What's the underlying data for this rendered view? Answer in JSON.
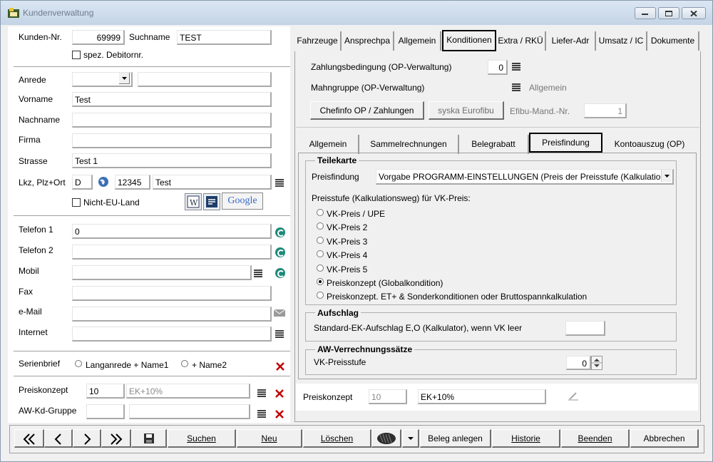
{
  "window": {
    "title": "Kundenverwaltung"
  },
  "left": {
    "kunden_nr_label": "Kunden-Nr.",
    "kunden_nr_value": "69999",
    "suchname_label": "Suchname",
    "suchname_value": "TEST",
    "spez_debitor_label": "spez. Debitornr.",
    "anrede_label": "Anrede",
    "anrede_value": "",
    "anrede_extra_value": "",
    "vorname_label": "Vorname",
    "vorname_value": "Test",
    "nachname_label": "Nachname",
    "nachname_value": "",
    "firma_label": "Firma",
    "firma_value": "",
    "strasse_label": "Strasse",
    "strasse_value": "Test 1",
    "lkz_label": "Lkz, Plz+Ort",
    "lkz_value": "D",
    "plz_value": "12345",
    "ort_value": "Test",
    "nicht_eu_label": "Nicht-EU-Land",
    "google_label": "Google",
    "telefon1_label": "Telefon 1",
    "telefon1_value": "0",
    "telefon2_label": "Telefon 2",
    "telefon2_value": "",
    "mobil_label": "Mobil",
    "mobil_value": "",
    "fax_label": "Fax",
    "fax_value": "",
    "email_label": "e-Mail",
    "email_value": "",
    "internet_label": "Internet",
    "internet_value": "",
    "serienbrief_label": "Serienbrief",
    "serienbrief_opt1": "Langanrede + Name1",
    "serienbrief_opt2": "+ Name2",
    "preiskonzept_label": "Preiskonzept",
    "preiskonzept_nr": "10",
    "preiskonzept_text": "EK+10%",
    "awkd_label": "AW-Kd-Gruppe",
    "awkd_nr": "",
    "awkd_text": ""
  },
  "top_tabs": [
    "Fahrzeuge",
    "Ansprechpa",
    "Allgemein",
    "Konditionen",
    "Extra / RKÜ",
    "Liefer-Adr",
    "Umsatz / IC",
    "Dokumente"
  ],
  "konditionen": {
    "zahlungsbedingung_label": "Zahlungsbedingung (OP-Verwaltung)",
    "zahlungsbedingung_value": "0",
    "mahngruppe_label": "Mahngruppe (OP-Verwaltung)",
    "mahngruppe_value": "Allgemein",
    "chefinfo_button": "Chefinfo OP / Zahlungen",
    "syska_button": "syska Eurofibu",
    "efibu_label": "Efibu-Mand.-Nr.",
    "efibu_value": "1"
  },
  "sub_tabs": [
    "Allgemein",
    "Sammelrechnungen",
    "Belegrabatt",
    "Preisfindung",
    "Kontoauszug (OP)"
  ],
  "preisfindung": {
    "teilekarte_title": "Teilekarte",
    "preisfindung_label": "Preisfindung",
    "preisfindung_value": "Vorgabe PROGRAMM-EINSTELLUNGEN (Preis der Preisstufe (Kalkulatio",
    "preisstufe_label": "Preisstufe (Kalkulationsweg) für VK-Preis:",
    "options": [
      "VK-Preis / UPE",
      "VK-Preis 2",
      "VK-Preis 3",
      "VK-Preis 4",
      "VK-Preis 5",
      "Preiskonzept (Globalkondition)",
      "Preiskonzept. ET+ & Sonderkonditionen oder Bruttospannkalkulation"
    ],
    "selected_option": 5,
    "aufschlag_title": "Aufschlag",
    "aufschlag_label": "Standard-EK-Aufschlag E,O (Kalkulator), wenn VK leer",
    "aufschlag_value": "",
    "aw_title": "AW-Verrechnungssätze",
    "vk_preisstufe_label": "VK-Preisstufe",
    "vk_preisstufe_value": "0"
  },
  "bottom_info": {
    "preiskonzept_label": "Preiskonzept",
    "preiskonzept_nr": "10",
    "preiskonzept_text": "EK+10%"
  },
  "toolbar": {
    "first": "«",
    "prev": "‹",
    "next": "›",
    "last": "»",
    "suchen": "Suchen",
    "neu": "Neu",
    "loeschen": "Löschen",
    "beleg_anlegen": "Beleg anlegen",
    "historie": "Historie",
    "beenden": "Beenden",
    "abbrechen": "Abbrechen"
  }
}
